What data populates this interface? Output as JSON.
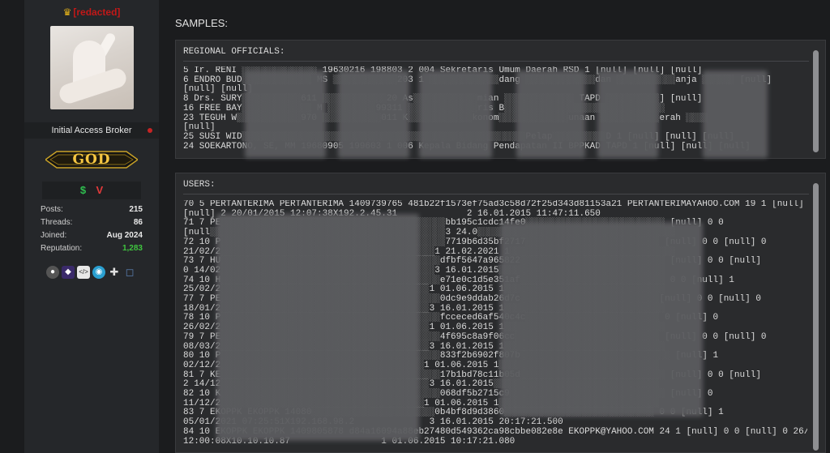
{
  "profile": {
    "username": "[redacted]",
    "role": "Initial Access Broker",
    "rank": "GOD",
    "badge_left": "$",
    "badge_right": "V",
    "stats": [
      {
        "label": "Posts:",
        "value": "215"
      },
      {
        "label": "Threads:",
        "value": "86"
      },
      {
        "label": "Joined:",
        "value": "Aug 2024"
      },
      {
        "label": "Reputation:",
        "value": "1,283"
      }
    ],
    "icons": [
      "user-icon",
      "hacker-icon",
      "code-icon",
      "globe-icon",
      "gamepad-icon",
      "chat-icon"
    ],
    "colors": {
      "username": "#c21818",
      "reputation": "#3fc43f",
      "rank": "#f5c642",
      "status_dot": "#c62424"
    }
  },
  "post": {
    "heading": "SAMPLES:",
    "regional": {
      "title": "REGIONAL OFFICIALS:",
      "lines": [
        "5 Ir. RENI ░░░░░░░░░░░░░░ 19630216 198803 2 004 Sekretaris Umum Daerah RSD 1 [null] [null] [null]",
        "6 ENDRO BUD░░░░░░░░░░░░░ MS ░░░░░░░░░░░░203 1 ░░░░░░░░░░░░░dang ░░░░░░░░░░░░░dan ░░░░░░░░░░░anja ░░░░░░ [null]",
        "[null] [null]",
        "8 Drs. SURY░░░░░░░░░░░611 ░░░░░░░░░░░░20 As░░░░░░░░░░░░mian ░░░░░░░░░░░░░ TAPD ░░░░░░░░░░] [null]",
        "16 FREE BAY░░░░░░░░░░░░░ M ░░░░░░░░░99311 ░░░░░░░░░░░░░ris B░░░░░░░░░░░░░░░░░░░░░░░░░░░░░░",
        "23 TEGUH W░░░░░░░░░░░░970 ░░░░░░░░░░░011 K░░░░░░░░░░░░konom░░░░░░░░░░░░░unaan ░░░░░░░░░░░erah ░░░░",
        "[null]",
        "25 SUSI WID░░░░░░░░░░░░░░░░░░░░░░░░░░░░░░░░░░░░░░░░░░░░░░░░░░░░░Pelap░░░░░░░░░░D 1 [null] [null] [null]",
        "24 SOEKARTONO, SE, MM 19680905 199603 1 006 Kepala Bidang Pendapatan II BPPKAD TAPD 1 [null] [null] [null]"
      ]
    },
    "users": {
      "title": "USERS:",
      "lines": [
        "70 5 PERTANTERIMA PERTANTERIMA 1409739765 481b22f1573ef75ad3c58d72f25d343d81153a21 PERTANTERIMAYAHOO.COM 19 1 [null] 0 0",
        "[null] 2 20/01/2015 12:07:38X192.2.45.31             2 16.01.2015 11:47:11.650",
        "71 7 PE░░░░░░░░░░░░░░░░░░░░░░░░░░░░░░░░░░░░░░░░░░bb195c1cdc14fe0░░░░░░░░░░░░░░░░░░░░░░░░░░ [null] 0 0",
        "[null░░░░░░░░░░░░░░░░░░░░░░░░░░░░░░░░░░░░░░░░░░░░3 24.0░░░░░░░░░░░░░░░░░░░░░░░░░░░░░░░░░░░░░",
        "72 10 P░░░░░░░░░░░░░░░░░░░░░░░░░░░░░░░░░░░░░░░░░░7719b6d35bf2717░░░░░░░░░░░░░░░░░░░░░░░░░ [null] 0 0 [null] 0",
        "21/02/2░░░░░░░░░░░░░░░░░░░░░░░░░░░░░░░░░░░░░░░░1 21.02.2021 1░░░░░░░░░░░░░░░░░░░░░░░░░░░░░░░",
        "73 7 HU░░░░░░░░░░░░░░░░░░░░░░░░░░░░░░░░░░░░░░░░░dfbf5647a965822░░░░░░░░░░░░░░░░░░░░░░░░░░░ [null] 0 0 [null]",
        "0 14/02░░░░░░░░░░░░░░░░░░░░░░░░░░░░░░░░░░░░░░░░3 16.01.2015░░░░░░░░░░░░░░░░░░░░░░░░░░░░░░░",
        "74 10 H░░░░░░░░░░░░░░░░░░░░░░░░░░░░░░░░░░░░░░░░░e71e0c1d5e351af░░░░░░░░░░░░░░░░░░░░░░░░░░░ 0 0 [null] 1",
        "25/02/2░░░░░░░░░░░░░░░░░░░░░░░░░░░░░░░░░░░░░░░1 01.06.2015 1░░░░░░░░░░░░░░░░░░░░░░░░░░░░░░",
        "77 7 PE░░░░░░░░░░░░░░░░░░░░░░░░░░░░░░░░░░░░░░░░░0dc9e9ddab26d7c░░░░░░░░░░░░░░░░░░░░░░░░░░[null] 0 0 [null] 0",
        "18/01/2░░░░░░░░░░░░░░░░░░░░░░░░░░░░░░░░░░░░░░░3 16.01.2015 1░░░░░░░░░░░░░░░░░░░░░░░░░░░░░░",
        "78 10 P░░░░░░░░░░░░░░░░░░░░░░░░░░░░░░░░░░░░░░░░░fcceced6af540c4c░░░░░░░░░░░░░░░░░░░░░░░░░ 0 [null] 0",
        "26/02/2░░░░░░░░░░░░░░░░░░░░░░░░░░░░░░░░░░░░░░░1 01.06.2015 1░░░░░░░░░░░░░░░░░░░░░░░░░░░░░░",
        "79 7 PE░░░░░░░░░░░░░░░░░░░░░░░░░░░░░░░░░░░░░░░░░4f695c8a9f06cc░░░░░░░░░░░░░░░░░░░░░░░░░░░ [null] 0 0 [null] 0",
        "08/03/2░░░░░░░░░░░░░░░░░░░░░░░░░░░░░░░░░░░░░░░3 16.01.2015 1░░░░░░░░░░░░░░░░░░░░░░░░░░░░░░",
        "80 10 P░░░░░░░░░░░░░░░░░░░░░░░░░░░░░░░░░░░░░░░░░833f2b6902f807b░░░░░░░░░░░░░░░░░░░░░░░░░░░░ [null] 1",
        "02/12/2░░░░░░░░░░░░░░░░░░░░░░░░░░░░░░░░░░░░░░1 01.06.2015 1░░░░░░░░░░░░░░░░░░░░░░░░░░░░░░",
        "81 7 KE░░░░░░░░░░░░░░░░░░░░░░░░░░░░░░░░░░░░░░░░░17b1bd78c11b05d░░░░░░░░░░░░░░░░░░░░░░░░░░░ [null] 0 0 [null]",
        "2 14/12░░░░░░░░░░░░░░░░░░░░░░░░░░░░░░░░░░░░░░░3 16.01.2015░░░░░░░░░░░░░░░░░░░░░░░░░░░░░░░",
        "82 10 K░░░░░░░░░░░░░░░░░░░░░░░░░░░░░░░░░░░░░░░░░068df5b2715c9░░░░░░░░░░░░░░░░░░░░░░░░░░░░░ [null] 0",
        "11/12/2░░░░░░░░░░░░░░░░░░░░░░░░░░░░░░░░░░░░░░1 01.06.2015 1░░░░░░░░░░░░░░░░░░░░░░░░░░░░░░",
        "83 7 EKOPPK EKOPPK 14080░░░░░░░░░░░░░░░░░░░░░░░0b4bf8d9d3860░░░░░░░░░░░░░░░░░░░░░░░░░░░░ 0 0 [null] 1",
        "05/01/2021 07:25:51X192.168.98.2              3 16.01.2015 20:17:21.500",
        "84 10 EKOPPK EKOPPK 1409805878 d84a16094a88eb27480d549362ca98cbbe082e8e EKOPPK@YAHOO.COM 24 1 [null] 0 0 [null] 0 26/02/2019",
        "12:00:08X10.10.10.87                 1 01.06.2015 10:17:21.080"
      ]
    }
  }
}
